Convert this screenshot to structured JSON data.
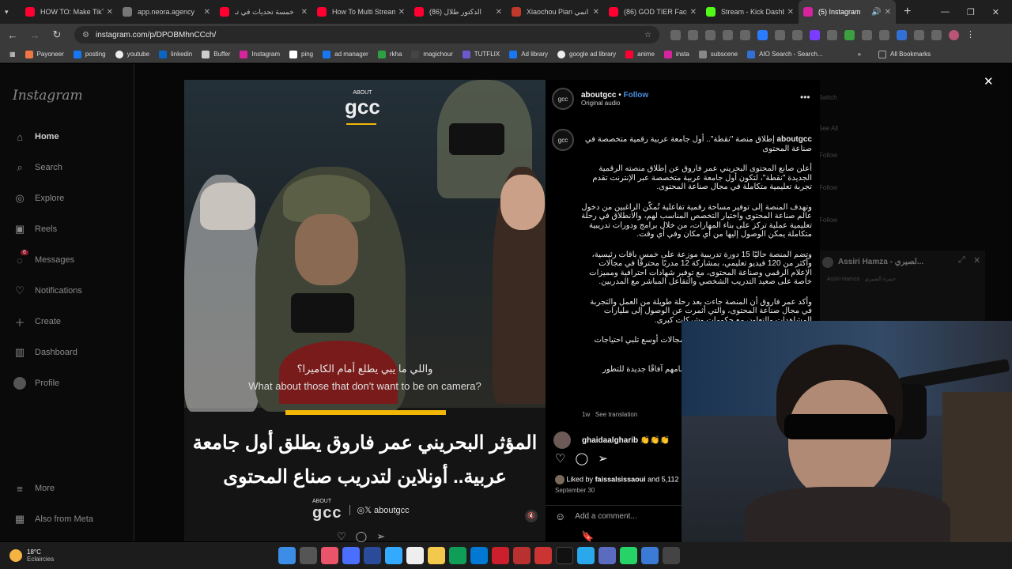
{
  "browser": {
    "tabs": [
      {
        "title": "HOW TO: Make TikT",
        "color": "#ff0033"
      },
      {
        "title": "app.neora.agency",
        "color": "#777777"
      },
      {
        "title": "خمسة تحديات في تـ",
        "color": "#ff0033"
      },
      {
        "title": "How To Multi Stream",
        "color": "#ff0033"
      },
      {
        "title": "(86) الدكتور طلال",
        "color": "#ff0033"
      },
      {
        "title": "Xiaochou Pian انمي",
        "color": "#c0392b"
      },
      {
        "title": "(86) GOD TIER Face",
        "color": "#ff0033"
      },
      {
        "title": "Stream - Kick Dashb",
        "color": "#53fc18"
      },
      {
        "title": "(5) Instagram",
        "color": "#d6249f"
      }
    ],
    "url": "instagram.com/p/DPOBMhnCCch/",
    "bookmarks": [
      "Payoneer",
      "posting",
      "youtube",
      "linkedin",
      "Buffer",
      "Instagram",
      "ping",
      "ad manager",
      "rkha",
      "magichour",
      "TUTFLIX",
      "Ad library",
      "google ad library",
      "anime",
      "insta",
      "subscene",
      "AIO Search - Search..."
    ],
    "all_bookmarks": "All Bookmarks"
  },
  "instagram": {
    "logo": "Instagram",
    "nav": [
      "Home",
      "Search",
      "Explore",
      "Reels",
      "Messages",
      "Notifications",
      "Create",
      "Dashboard",
      "Profile"
    ],
    "more": "More",
    "meta": "Also from Meta",
    "messages_badge": "6"
  },
  "video": {
    "logo_small": "ABOUT",
    "logo_big": "gcc",
    "subtitle_ar": "واللي ما يبي يطلع أمام الكاميرا؟",
    "subtitle_en": "What about those that don't want to be on camera?",
    "headline": "المؤثر البحريني عمر فاروق يطلق أول جامعة عربية.. أونلاين لتدريب صناع المحتوى",
    "handle": "◎𝕏 aboutgcc"
  },
  "post": {
    "username": "aboutgcc",
    "follow": "Follow",
    "audio": "Original audio",
    "caption_title": "إطلاق منصة \"نقطة\".. أول جامعة عربية رقمية متخصصة في صناعة المحتوى",
    "paragraphs": [
      "أعلن صانع المحتوى البحريني عمر فاروق عن إطلاق منصته الرقمية الجديدة \"نقطة\"، لتكون أول جامعة عربية متخصصة عبر الإنترنت تقدم تجربة تعليمية متكاملة في مجال صناعة المحتوى.",
      "وتهدف المنصة إلى توفير مساحة رقمية تفاعلية تُمكّن الراغبين من دخول عالم صناعة المحتوى واختيار التخصص المناسب لهم، والانطلاق في رحلة تعليمية عملية تركز على بناء المهارات، من خلال برامج ودورات تدريبية متكاملة يمكن الوصول إليها من أي مكان وفي أي وقت.",
      "وتضم المنصة حاليًا 15 دورة تدريبية موزعة على خمس باقات رئيسية، وأكثر من 120 فيديو تعليمي، بمشاركة 12 مدربًا محترفًا في مجالات الإعلام الرقمي وصناعة المحتوى، مع توفير شهادات احترافية ومميزات خاصة على صعيد التدريب الشخصي والتفاعل المباشر مع المدربين.",
      "وأكد عمر فاروق أن المنصة جاءت بعد رحلة طويلة من العمل والتجربة في مجال صناعة المحتوى، والتي أثمرت عن الوصول إلى مليارات المشاهدات والتعاون مع حكومات وشركات كبرى.",
      "مستقبلًا يشمل زيادة عدد المدربين على مجالات أوسع تلبي احتياجات صناع المحتوى بمختلف مستوياتهم.",
      "قطاع التعليم الرقمي، حيث توفر وتفتح أمامهم آفاقًا جديدة للتطور والتأثير في العالم الرقمي"
    ],
    "time": "1w",
    "see_translation": "See translation",
    "comment_user": "ghaidaalgharib",
    "comment_text": "👏👏👏",
    "liked_by_prefix": "Liked by",
    "liked_by_user": "faissalsissaoui",
    "liked_by_suffix": "and 5,112",
    "date": "September 30",
    "add_comment": "Add a comment..."
  },
  "popup": {
    "title": "Assiri Hamza - لصيري...",
    "sub": "Assiri Hamza · حمزة الصيري"
  },
  "ghost_sidebar": [
    "Switch",
    "See All",
    "Follow",
    "Follow",
    "Follow"
  ],
  "taskbar": {
    "temp": "18°C",
    "weather": "Eclaircies"
  }
}
